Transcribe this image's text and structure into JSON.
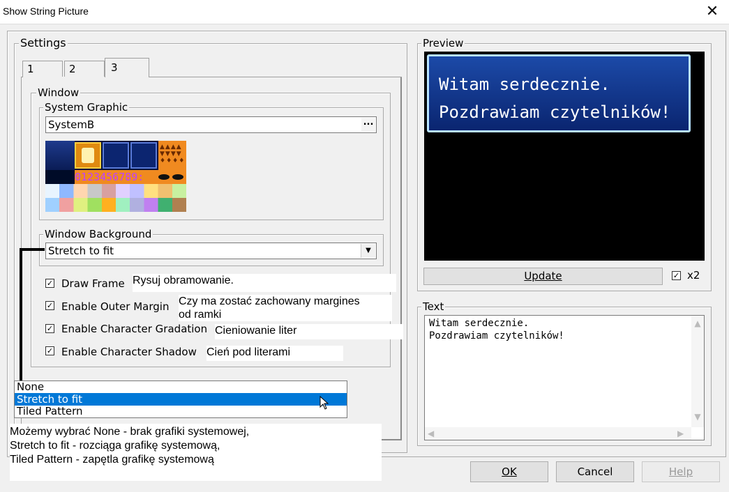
{
  "window": {
    "title": "Show String Picture",
    "close_glyph": "✕"
  },
  "settings": {
    "legend": "Settings",
    "tabs": [
      {
        "label": "1"
      },
      {
        "label": "2"
      },
      {
        "label": "3"
      }
    ],
    "window_group": {
      "legend": "Window",
      "system_graphic": {
        "legend": "System Graphic",
        "value": "SystemB",
        "browse_label": "..."
      },
      "preview_sample_text": "0123456789:",
      "window_background": {
        "legend": "Window Background",
        "selected": "Stretch to fit",
        "arrow": "▼"
      },
      "checkboxes": [
        {
          "label": "Draw Frame",
          "checked": true
        },
        {
          "label": "Enable Outer Margin",
          "checked": true
        },
        {
          "label": "Enable Character Gradation",
          "checked": true
        },
        {
          "label": "Enable Character Shadow",
          "checked": true
        }
      ]
    },
    "dropdown_options": [
      {
        "label": "None"
      },
      {
        "label": "Stretch to fit",
        "selected": true
      },
      {
        "label": "Tiled Pattern"
      }
    ]
  },
  "notes": {
    "draw_frame": "Rysuj obramowanie.",
    "outer_margin_line1": "Czy ma zostać zachowany margines",
    "outer_margin_line2": "od ramki",
    "gradation": "Cieniowanie liter",
    "shadow": "Cień pod literami",
    "dropdown_line1": "Możemy wybrać None - brak grafiki systemowej,",
    "dropdown_line2": "Stretch to fit - rozciąga grafikę systemową,",
    "dropdown_line3": "Tiled Pattern - zapętla grafikę systemową"
  },
  "preview": {
    "legend": "Preview",
    "line1": "Witam serdecznie.",
    "line2": "Pozdrawiam czytelników!",
    "update_label": "Update",
    "x2_label": "x2",
    "x2_checked": true
  },
  "text": {
    "legend": "Text",
    "line1": "Witam serdecznie.",
    "line2": "Pozdrawiam czytelników!"
  },
  "footer": {
    "ok_label": "OK",
    "cancel_label": "Cancel",
    "help_label": "Help"
  },
  "colors": {
    "selection": "#0078d7",
    "preview_window": "#0b2a6a",
    "preview_text": "#ffffff"
  }
}
